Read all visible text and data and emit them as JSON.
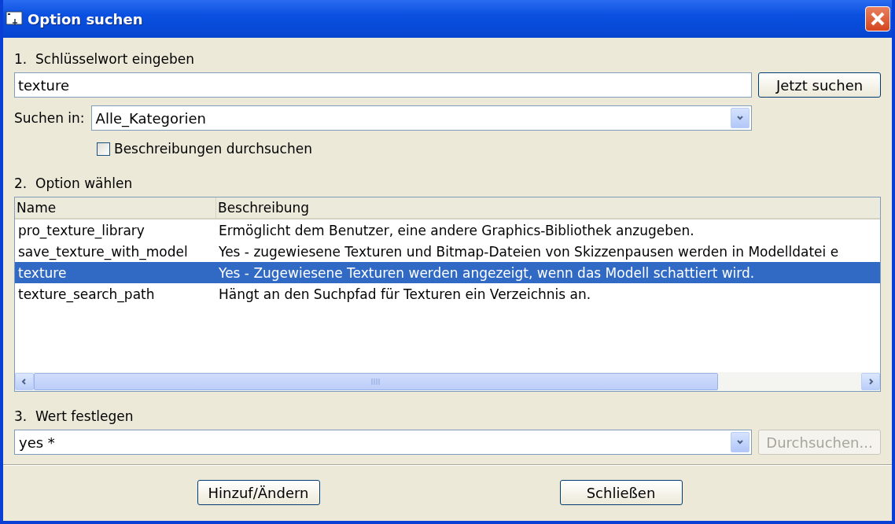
{
  "window": {
    "title": "Option suchen"
  },
  "step1": {
    "label": "1.  Schlüsselwort eingeben",
    "keyword": {
      "value": "texture"
    },
    "search_button": "Jetzt suchen",
    "search_in": {
      "label": "Suchen in:",
      "value": "Alle_Kategorien"
    },
    "search_descriptions": {
      "label": "Beschreibungen durchsuchen",
      "checked": false
    }
  },
  "step2": {
    "label": "2.  Option wählen",
    "table": {
      "columns": [
        "Name",
        "Beschreibung"
      ],
      "rows": [
        {
          "name": "pro_texture_library",
          "description": "Ermöglicht dem Benutzer, eine andere Graphics-Bibliothek anzugeben.",
          "selected": false
        },
        {
          "name": "save_texture_with_model",
          "description": "Yes - zugewiesene Texturen und Bitmap-Dateien von Skizzenpausen werden in Modelldatei e",
          "selected": false
        },
        {
          "name": "texture",
          "description": "Yes - Zugewiesene Texturen werden angezeigt, wenn das Modell schattiert wird.",
          "selected": true
        },
        {
          "name": "texture_search_path",
          "description": "Hängt an den Suchpfad für Texturen ein Verzeichnis an.",
          "selected": false
        }
      ]
    }
  },
  "step3": {
    "label": "3.  Wert festlegen",
    "value": "yes *",
    "browse_button": {
      "label": "Durchsuchen...",
      "disabled": true
    }
  },
  "buttons": [
    "Hinzuf/Ändern",
    "Schließen"
  ]
}
